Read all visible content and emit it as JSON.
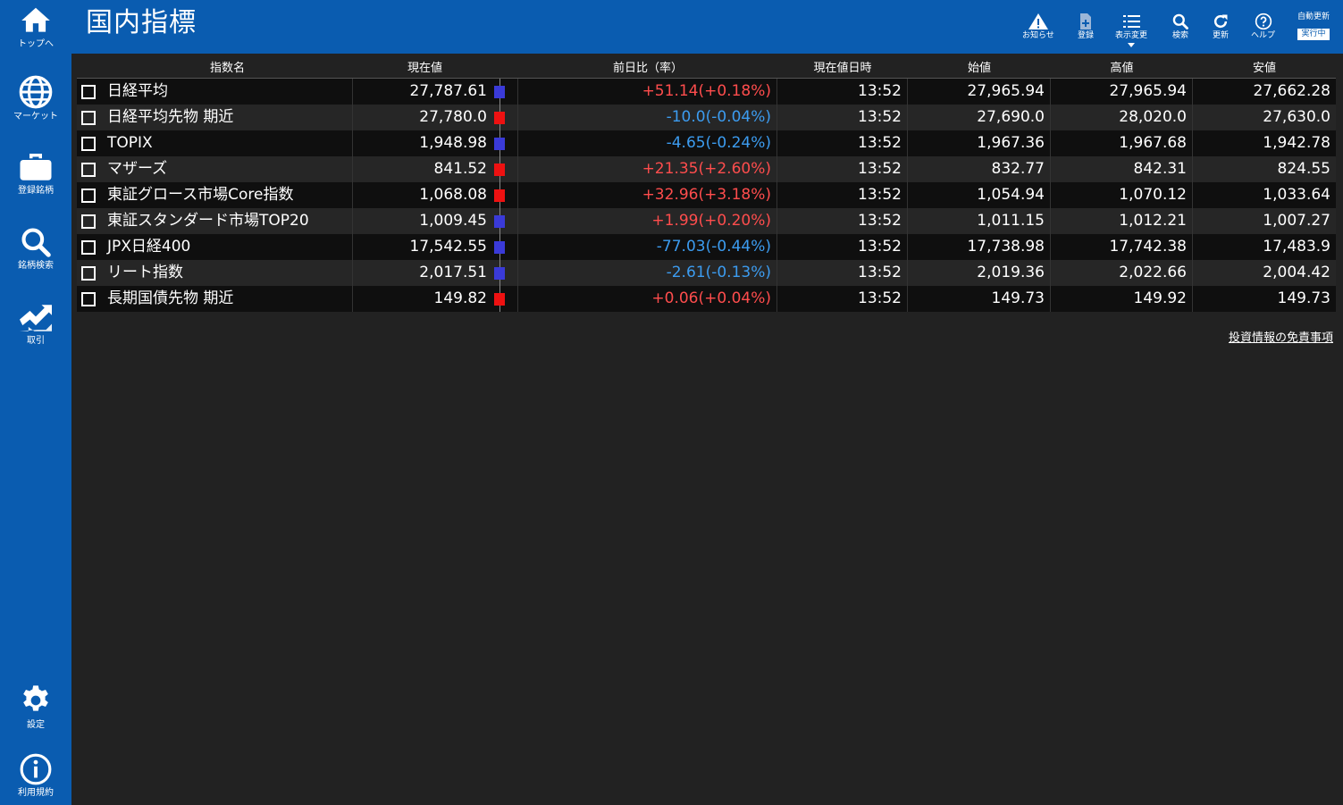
{
  "colors": {
    "brand": "#0a5cb0",
    "up": "#ff4d4d",
    "down": "#3c9cf0",
    "up_bar": "#ee1111",
    "down_bar": "#3a3ad8"
  },
  "sidebar": {
    "items": [
      {
        "label": "トップへ",
        "icon": "home-icon"
      },
      {
        "label": "マーケット",
        "icon": "globe-icon"
      },
      {
        "label": "登録銘柄",
        "icon": "briefcase-icon"
      },
      {
        "label": "銘柄検索",
        "icon": "search-icon"
      },
      {
        "label": "取引",
        "icon": "trade-icon"
      },
      {
        "label": "設定",
        "icon": "gear-icon"
      },
      {
        "label": "利用規約",
        "icon": "info-icon"
      }
    ]
  },
  "header": {
    "title": "国内指標",
    "tools": [
      {
        "label": "お知らせ",
        "icon": "warning-icon"
      },
      {
        "label": "登録",
        "icon": "document-add-icon"
      },
      {
        "label": "表示変更",
        "icon": "list-icon"
      },
      {
        "label": "検索",
        "icon": "search-icon"
      },
      {
        "label": "更新",
        "icon": "refresh-icon"
      },
      {
        "label": "ヘルプ",
        "icon": "help-icon"
      }
    ],
    "auto_refresh": {
      "title": "自動更新",
      "status": "実行中"
    }
  },
  "table": {
    "columns": [
      "指数名",
      "現在値",
      "前日比（率）",
      "現在値日時",
      "始値",
      "高値",
      "安値"
    ],
    "rows": [
      {
        "name": "日経平均",
        "price": "27,787.61",
        "bar": "down",
        "change": "+51.14(+0.18%)",
        "dir": "up",
        "time": "13:52",
        "open": "27,965.94",
        "high": "27,965.94",
        "low": "27,662.28"
      },
      {
        "name": "日経平均先物 期近",
        "price": "27,780.0",
        "bar": "up",
        "change": "-10.0(-0.04%)",
        "dir": "down",
        "time": "13:52",
        "open": "27,690.0",
        "high": "28,020.0",
        "low": "27,630.0"
      },
      {
        "name": "TOPIX",
        "price": "1,948.98",
        "bar": "down",
        "change": "-4.65(-0.24%)",
        "dir": "down",
        "time": "13:52",
        "open": "1,967.36",
        "high": "1,967.68",
        "low": "1,942.78"
      },
      {
        "name": "マザーズ",
        "price": "841.52",
        "bar": "up",
        "change": "+21.35(+2.60%)",
        "dir": "up",
        "time": "13:52",
        "open": "832.77",
        "high": "842.31",
        "low": "824.55"
      },
      {
        "name": "東証グロース市場Core指数",
        "price": "1,068.08",
        "bar": "up",
        "change": "+32.96(+3.18%)",
        "dir": "up",
        "time": "13:52",
        "open": "1,054.94",
        "high": "1,070.12",
        "low": "1,033.64"
      },
      {
        "name": "東証スタンダード市場TOP20",
        "price": "1,009.45",
        "bar": "down",
        "change": "+1.99(+0.20%)",
        "dir": "up",
        "time": "13:52",
        "open": "1,011.15",
        "high": "1,012.21",
        "low": "1,007.27"
      },
      {
        "name": "JPX日経400",
        "price": "17,542.55",
        "bar": "down",
        "change": "-77.03(-0.44%)",
        "dir": "down",
        "time": "13:52",
        "open": "17,738.98",
        "high": "17,742.38",
        "low": "17,483.9"
      },
      {
        "name": "リート指数",
        "price": "2,017.51",
        "bar": "down",
        "change": "-2.61(-0.13%)",
        "dir": "down",
        "time": "13:52",
        "open": "2,019.36",
        "high": "2,022.66",
        "low": "2,004.42"
      },
      {
        "name": "長期国債先物 期近",
        "price": "149.82",
        "bar": "up",
        "change": "+0.06(+0.04%)",
        "dir": "up",
        "time": "13:52",
        "open": "149.73",
        "high": "149.92",
        "low": "149.73"
      }
    ]
  },
  "footer": {
    "disclaimer": "投資情報の免責事項"
  }
}
